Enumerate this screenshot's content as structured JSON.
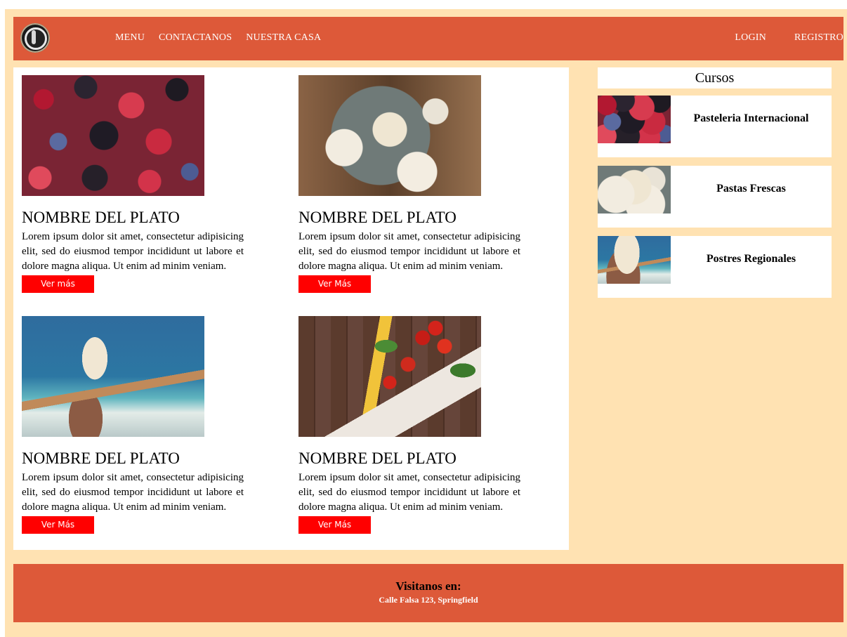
{
  "nav": {
    "left": [
      "MENU",
      "CONTACTANOS",
      "NUESTRA CASA"
    ],
    "right": [
      "LOGIN",
      "REGISTRO"
    ],
    "logo_icon": "spoon-plate-icon"
  },
  "dishes": [
    {
      "title": "NOMBRE DEL PLATO",
      "text": "Lorem ipsum dolor sit amet, consectetur adipisicing elit, sed do eiusmod tempor incididunt ut labore et dolore magna aliqua. Ut enim ad minim veniam.",
      "button": "Ver más",
      "image": "berries"
    },
    {
      "title": "NOMBRE DEL PLATO",
      "text": "Lorem ipsum dolor sit amet, consectetur adipisicing elit, sed do eiusmod tempor incididunt ut labore et dolore magna aliqua. Ut enim ad minim veniam.",
      "button": "Ver Más",
      "image": "table-top"
    },
    {
      "title": "NOMBRE DEL PLATO",
      "text": "Lorem ipsum dolor sit amet, consectetur adipisicing elit, sed do eiusmod tempor incididunt ut labore et dolore magna aliqua. Ut enim ad minim veniam.",
      "button": "Ver Más",
      "image": "icecream"
    },
    {
      "title": "NOMBRE DEL PLATO",
      "text": "Lorem ipsum dolor sit amet, consectetur adipisicing elit, sed do eiusmod tempor incididunt ut labore et dolore magna aliqua. Ut enim ad minim veniam.",
      "button": "Ver Más",
      "image": "tomatoes"
    }
  ],
  "sidebar": {
    "title": "Cursos",
    "courses": [
      {
        "label": "Pasteleria Internacional",
        "image": "berries"
      },
      {
        "label": "Pastas Frescas",
        "image": "table-top"
      },
      {
        "label": "Postres Regionales",
        "image": "icecream"
      }
    ]
  },
  "footer": {
    "title": "Visitanos en:",
    "address": "Calle Falsa 123, Springfield"
  },
  "colors": {
    "background": "#ffe2b2",
    "bar": "#dd5939",
    "button": "#ff0000"
  }
}
